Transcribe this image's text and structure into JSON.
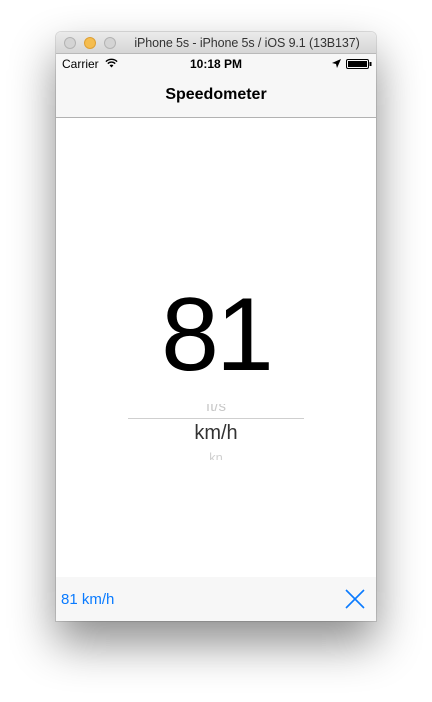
{
  "window": {
    "title": "iPhone 5s - iPhone 5s / iOS 9.1 (13B137)"
  },
  "statusbar": {
    "carrier": "Carrier",
    "time": "10:18 PM"
  },
  "navbar": {
    "title": "Speedometer"
  },
  "speed": {
    "value": "81"
  },
  "unit_picker": {
    "previous": "ft/s",
    "selected": "km/h",
    "next": "kn"
  },
  "toolbar": {
    "speed_label": "81 km/h",
    "accent_color": "#0a7bff"
  },
  "icons": [
    "wifi-icon",
    "location-arrow-icon",
    "battery-icon",
    "close-icon"
  ]
}
